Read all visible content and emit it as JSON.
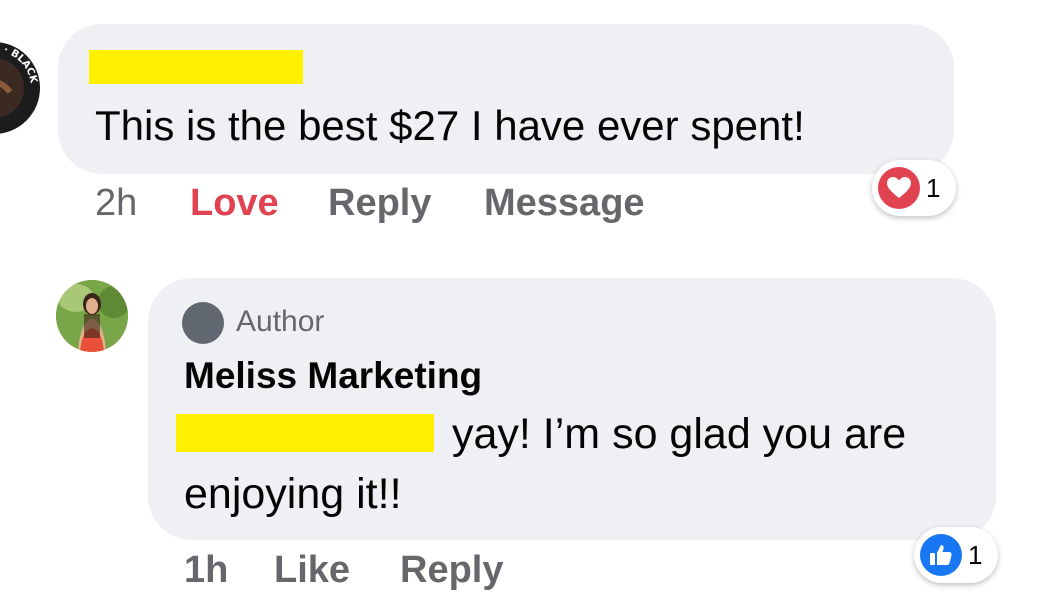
{
  "comment": {
    "text": "This is the best $27 I have ever spent!",
    "time": "2h",
    "actions": {
      "love": "Love",
      "reply": "Reply",
      "message": "Message"
    },
    "reaction": {
      "icon": "heart-icon",
      "count": "1",
      "color": "#e0424f"
    },
    "avatar": {
      "ring_text": "MATTER · BLACK"
    }
  },
  "reply": {
    "badge": "Author",
    "author": "Meliss Marketing",
    "text_line1": "yay! I’m so glad you are",
    "text_line2": "enjoying it!!",
    "time": "1h",
    "actions": {
      "like": "Like",
      "reply": "Reply"
    },
    "reaction": {
      "icon": "thumbs-up-icon",
      "count": "1",
      "color": "#1877f2"
    }
  },
  "colors": {
    "bubble": "#eff0f3",
    "meta": "#65676b",
    "redaction": "#ffef00"
  }
}
